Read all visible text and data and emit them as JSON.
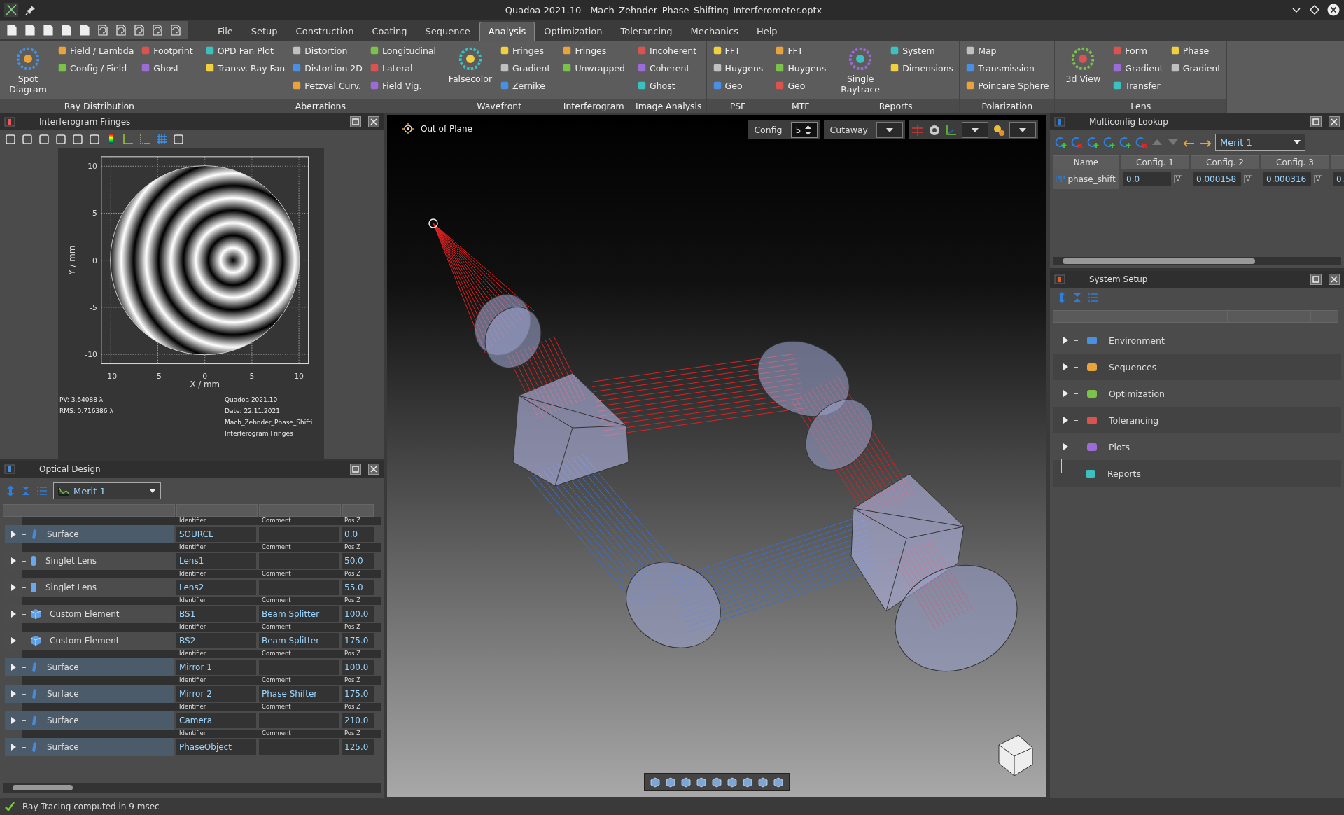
{
  "window": {
    "title": "Quadoa 2021.10 - Mach_Zehnder_Phase_Shifting_Interferometer.optx"
  },
  "menu": [
    {
      "label": "File",
      "selected": false
    },
    {
      "label": "Setup",
      "selected": false
    },
    {
      "label": "Construction",
      "selected": false
    },
    {
      "label": "Coating",
      "selected": false
    },
    {
      "label": "Sequence",
      "selected": false
    },
    {
      "label": "Analysis",
      "selected": true
    },
    {
      "label": "Optimization",
      "selected": false
    },
    {
      "label": "Tolerancing",
      "selected": false
    },
    {
      "label": "Mechanics",
      "selected": false
    },
    {
      "label": "Help",
      "selected": false
    }
  ],
  "ribbon": [
    {
      "title": "Ray Distribution",
      "columns": [
        {
          "kind": "large",
          "items": [
            "Spot Diagram"
          ]
        },
        {
          "kind": "small",
          "items": [
            "Field / Lambda",
            "Config / Field"
          ]
        },
        {
          "kind": "small",
          "items": [
            "Footprint",
            "Ghost"
          ]
        }
      ]
    },
    {
      "title": "Aberrations",
      "columns": [
        {
          "kind": "small",
          "items": [
            "OPD Fan Plot",
            "Transv. Ray Fan"
          ]
        },
        {
          "kind": "small",
          "items": [
            "Distortion",
            "Distortion 2D",
            "Petzval Curv."
          ]
        },
        {
          "kind": "small",
          "items": [
            "Longitudinal",
            "Lateral",
            "Field Vig."
          ]
        }
      ]
    },
    {
      "title": "Wavefront",
      "columns": [
        {
          "kind": "large",
          "items": [
            "Falsecolor"
          ]
        },
        {
          "kind": "small",
          "items": [
            "Fringes",
            "Gradient",
            "Zernike"
          ]
        }
      ]
    },
    {
      "title": "Interferogram",
      "columns": [
        {
          "kind": "small",
          "items": [
            "Fringes",
            "Unwrapped"
          ]
        }
      ]
    },
    {
      "title": "Image Analysis",
      "columns": [
        {
          "kind": "small",
          "items": [
            "Incoherent",
            "Coherent",
            "Ghost"
          ]
        }
      ]
    },
    {
      "title": "PSF",
      "columns": [
        {
          "kind": "small",
          "items": [
            "FFT",
            "Huygens",
            "Geo"
          ]
        }
      ]
    },
    {
      "title": "MTF",
      "columns": [
        {
          "kind": "small",
          "items": [
            "FFT",
            "Huygens",
            "Geo"
          ]
        }
      ]
    },
    {
      "title": "Reports",
      "columns": [
        {
          "kind": "large",
          "items": [
            "Single Raytrace"
          ]
        },
        {
          "kind": "small",
          "items": [
            "System",
            "Dimensions"
          ]
        }
      ]
    },
    {
      "title": "Polarization",
      "columns": [
        {
          "kind": "small",
          "items": [
            "Map",
            "Transmission",
            "Poincare Sphere"
          ]
        }
      ]
    },
    {
      "title": "Lens",
      "columns": [
        {
          "kind": "large",
          "items": [
            "3d View"
          ]
        },
        {
          "kind": "small",
          "items": [
            "Form",
            "Gradient",
            "Transfer"
          ]
        },
        {
          "kind": "small",
          "items": [
            "Phase",
            "Gradient"
          ]
        }
      ]
    }
  ],
  "interferogram": {
    "title": "Interferogram Fringes",
    "xlabel": "X / mm",
    "ylabel": "Y / mm",
    "x_ticks": [
      "-10",
      "-5",
      "0",
      "5",
      "10"
    ],
    "y_ticks": [
      "10",
      "5",
      "0",
      "-5",
      "-10"
    ],
    "stats": [
      "PV: 3.64088 λ",
      "RMS: 0.716386 λ"
    ],
    "info": [
      "Quadoa 2021.10",
      "Date: 22.11.2021",
      "Mach_Zehnder_Phase_Shifti...",
      "Interferogram Fringes"
    ]
  },
  "optical_design": {
    "title": "Optical Design",
    "merit": "Merit 1",
    "rows": [
      {
        "kind": "surface",
        "name": "Surface",
        "identifier_label": "Identifier",
        "identifier": "SOURCE",
        "comment_label": "Comment",
        "pos_z_label": "Pos Z",
        "pos_z": "0.0"
      },
      {
        "kind": "singlet-lens",
        "name": "Singlet Lens",
        "identifier_label": "Identifier",
        "identifier": "Lens1",
        "comment_label": "Comment",
        "pos_z_label": "Pos Z",
        "pos_z": "50.0"
      },
      {
        "kind": "singlet-lens",
        "name": "Singlet Lens",
        "identifier_label": "Identifier",
        "identifier": "Lens2",
        "comment_label": "Comment",
        "pos_z_label": "Pos Z",
        "pos_z": "55.0"
      },
      {
        "kind": "custom-element",
        "name": "Custom Element",
        "identifier_label": "Identifier",
        "identifier": "BS1",
        "comment_label": "Comment",
        "comment": "Beam Splitter",
        "pos_z_label": "Pos Z",
        "pos_z": "100.0"
      },
      {
        "kind": "custom-element",
        "name": "Custom Element",
        "identifier_label": "Identifier",
        "identifier": "BS2",
        "comment_label": "Comment",
        "comment": "Beam Splitter",
        "pos_z_label": "Pos Z",
        "pos_z": "175.0"
      },
      {
        "kind": "surface",
        "name": "Surface",
        "identifier_label": "Identifier",
        "identifier": "Mirror 1",
        "comment_label": "Comment",
        "pos_z_label": "Pos Z",
        "pos_z": "100.0"
      },
      {
        "kind": "surface",
        "name": "Surface",
        "identifier_label": "Identifier",
        "identifier": "Mirror 2",
        "comment_label": "Comment",
        "comment": "Phase Shifter",
        "pos_z_label": "Pos Z",
        "pos_z": "175.0"
      },
      {
        "kind": "surface",
        "name": "Surface",
        "identifier_label": "Identifier",
        "identifier": "Camera",
        "comment_label": "Comment",
        "pos_z_label": "Pos Z",
        "pos_z": "210.0"
      },
      {
        "kind": "surface",
        "name": "Surface",
        "identifier_label": "Identifier",
        "identifier": "PhaseObject",
        "comment_label": "Comment",
        "pos_z_label": "Pos Z",
        "pos_z": "125.0"
      }
    ]
  },
  "viewport": {
    "view_label": "Out of Plane",
    "config_label": "Config",
    "config_value": "5",
    "cutaway_label": "Cutaway"
  },
  "multiconfig": {
    "title": "Multiconfig Lookup",
    "merit": "Merit 1",
    "columns": [
      "Name",
      "Config. 1",
      "Config. 2",
      "Config. 3"
    ],
    "rows": [
      {
        "badge": "PP",
        "name": "phase_shift",
        "values": [
          {
            "value": "0.0",
            "flag": "V"
          },
          {
            "value": "0.000158",
            "flag": "V"
          },
          {
            "value": "0.000316",
            "flag": "V"
          },
          {
            "value": "0."
          }
        ]
      }
    ]
  },
  "system_setup": {
    "title": "System Setup",
    "items": [
      {
        "kind": "group",
        "label": "Environment",
        "expanded": false
      },
      {
        "kind": "group",
        "label": "Sequences",
        "expanded": false
      },
      {
        "kind": "group",
        "label": "Optimization",
        "expanded": false
      },
      {
        "kind": "group",
        "label": "Tolerancing",
        "expanded": false
      },
      {
        "kind": "group",
        "label": "Plots",
        "expanded": false
      },
      {
        "kind": "leaf",
        "label": "Reports"
      }
    ]
  },
  "status_bar": {
    "message": "Ray Tracing computed in 9 msec"
  }
}
